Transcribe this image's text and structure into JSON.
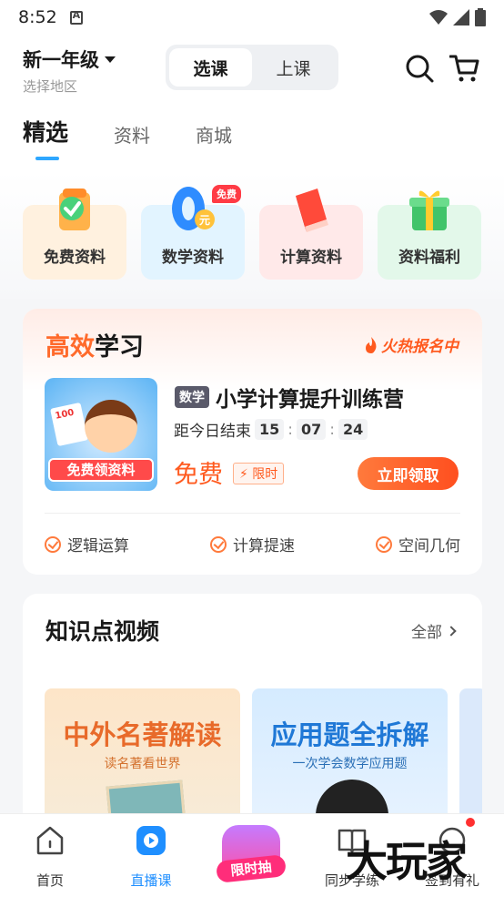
{
  "status_bar": {
    "time": "8:52"
  },
  "header": {
    "grade": "新一年级",
    "region": "选择地区",
    "segments": [
      "选课",
      "上课"
    ],
    "active_segment": "选课"
  },
  "tabs": [
    "精选",
    "资料",
    "商城"
  ],
  "quick_items": [
    {
      "label": "免费资料",
      "bg": "#fff1df"
    },
    {
      "label": "数学资料",
      "bg": "#e2f4ff",
      "badge": "免费"
    },
    {
      "label": "计算资料",
      "bg": "#ffe9e9"
    },
    {
      "label": "资料福利",
      "bg": "#e3f8ea"
    }
  ],
  "promo_card": {
    "title_highlight": "高效",
    "title_rest": "学习",
    "hot_label": "火热报名中",
    "cover_paper": "100",
    "cover_banner": "免费领资料",
    "subject_tag": "数学",
    "course_title": "小学计算提升训练营",
    "countdown_label": "距今日结束",
    "countdown": [
      "15",
      "07",
      "24"
    ],
    "price": "免费",
    "limit_tag": "限时",
    "cta": "立即领取",
    "features": [
      "逻辑运算",
      "计算提速",
      "空间几何"
    ]
  },
  "videos_section": {
    "title": "知识点视频",
    "all_label": "全部",
    "videos": [
      {
        "title": "中外名著解读",
        "subtitle": "读名著看世界"
      },
      {
        "title": "应用题全拆解",
        "subtitle": "一次学会数学应用题"
      }
    ]
  },
  "tab_bar": {
    "items": [
      "首页",
      "直播课",
      "同步学练",
      "签到有礼"
    ],
    "active": "直播课",
    "lucky_label": "限时抽"
  },
  "watermark": "大玩家",
  "colors": {
    "accent_blue": "#1f8fff",
    "accent_orange": "#ff5a1f"
  }
}
